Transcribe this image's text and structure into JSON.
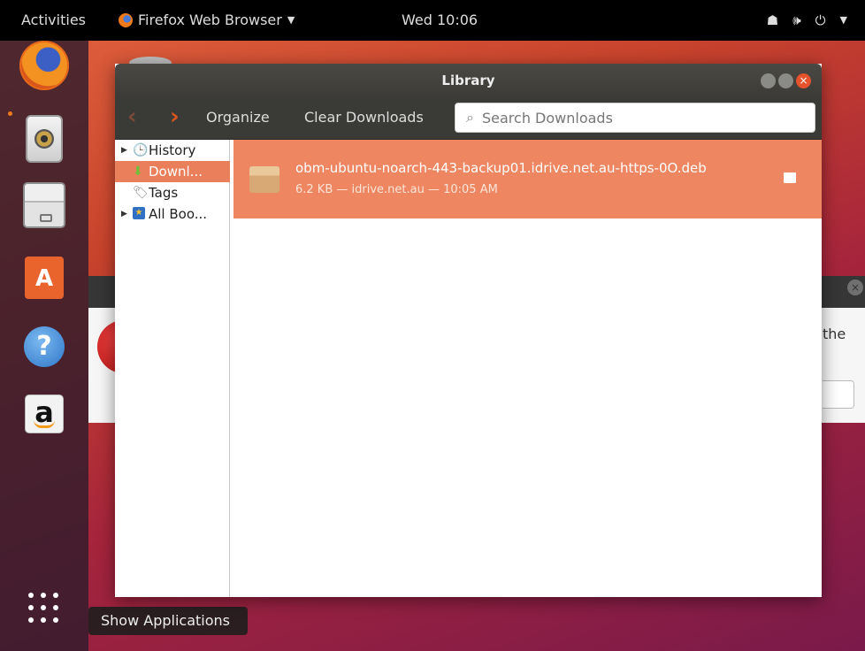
{
  "topbar": {
    "activities": "Activities",
    "app_menu": "Firefox Web Browser",
    "clock": "Wed 10:06",
    "tray_icons": [
      "network-icon",
      "volume-icon",
      "power-icon"
    ]
  },
  "dock": {
    "items": [
      "firefox",
      "rhythmbox",
      "files",
      "ubuntu-software",
      "help",
      "amazon"
    ],
    "software_glyph": "A",
    "help_glyph": "?",
    "amazon_glyph": "a",
    "tooltip": "Show Applications"
  },
  "background_dialog": {
    "visible_text": "the"
  },
  "library": {
    "title": "Library",
    "toolbar": {
      "organize_label": "Organize",
      "clear_downloads_label": "Clear Downloads",
      "search_placeholder": "Search Downloads"
    },
    "sidebar": {
      "history": "History",
      "downloads": "Downl...",
      "tags": "Tags",
      "all_bookmarks": "All Boo..."
    },
    "downloads": [
      {
        "filename": "obm-ubuntu-noarch-443-backup01.idrive.net.au-https-0O.deb",
        "meta": "6.2 KB — idrive.net.au — 10:05 AM"
      }
    ]
  },
  "colors": {
    "accent": "#e9805b",
    "selection": "#ed8661",
    "titlebar": "#3c3b37",
    "close_button": "#e5522c"
  }
}
